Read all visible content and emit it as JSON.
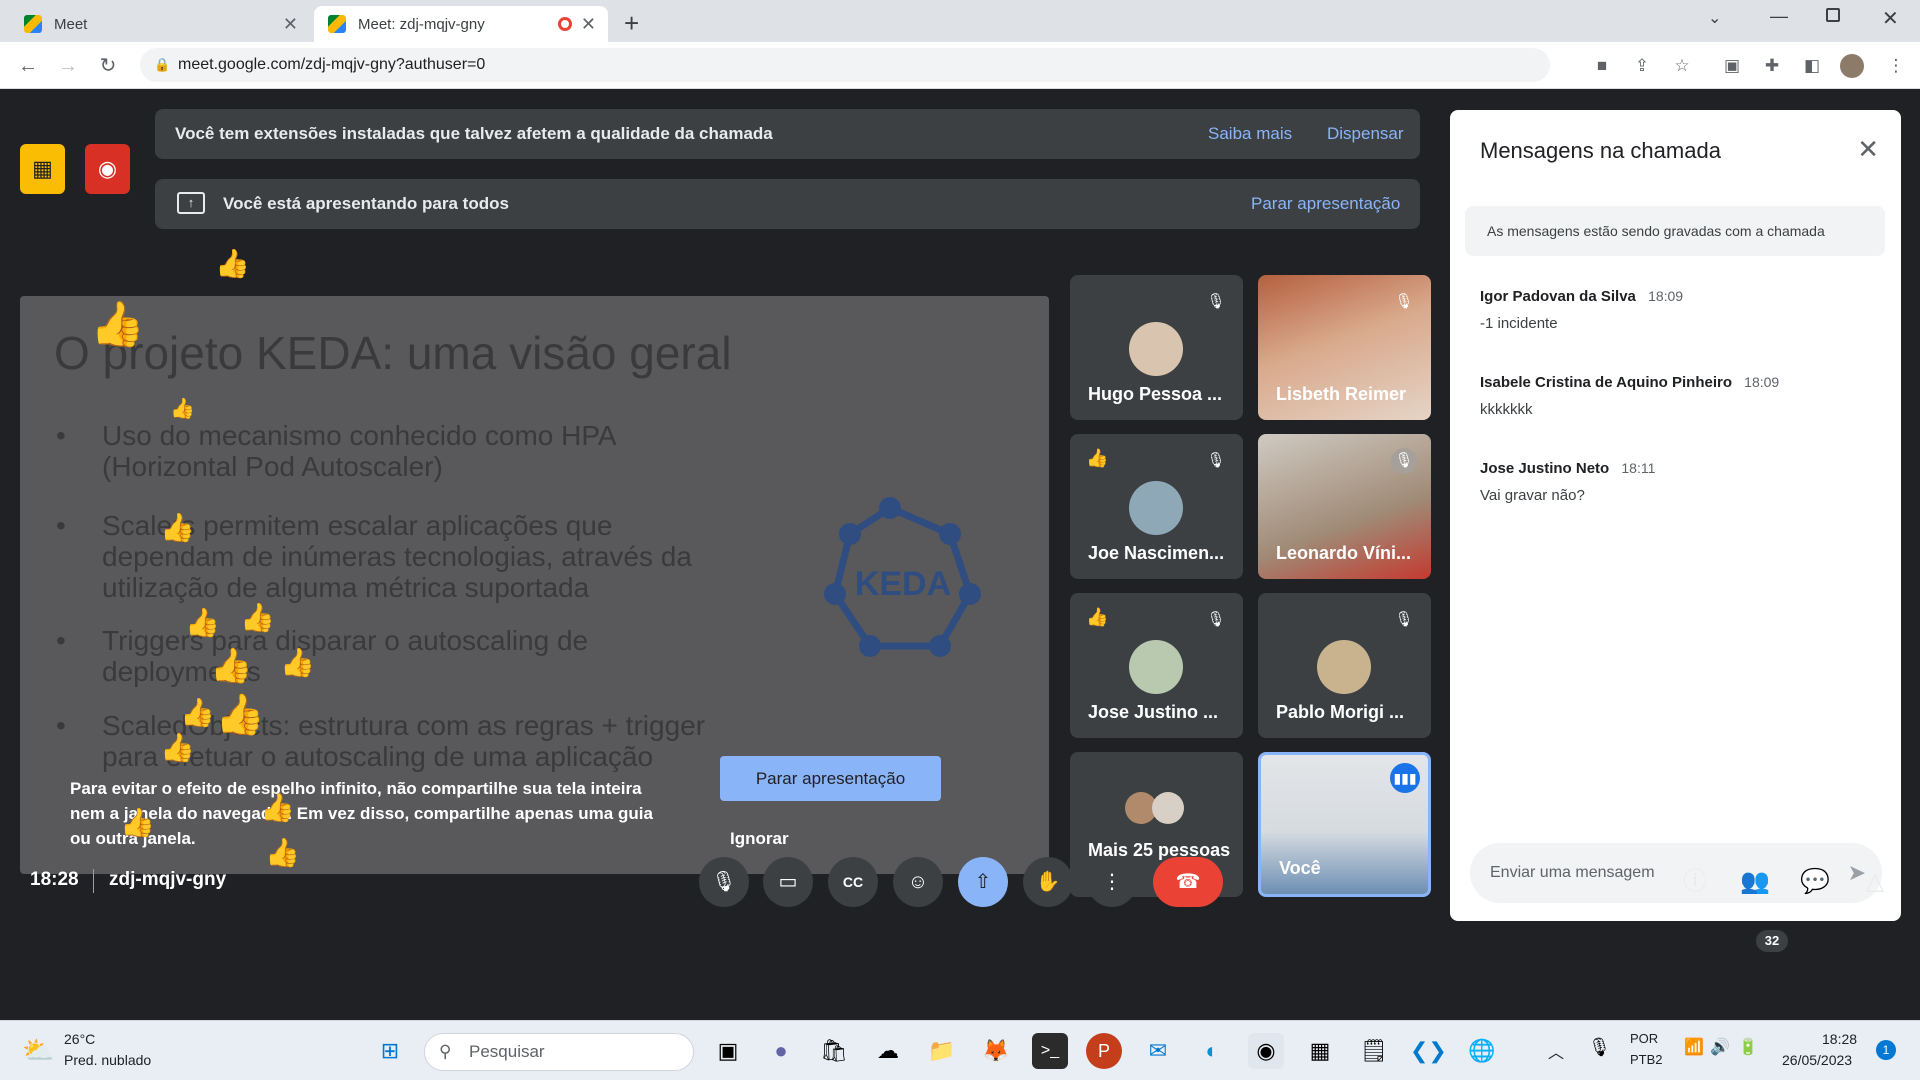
{
  "browser": {
    "tabs": [
      {
        "title": "Meet",
        "active": false
      },
      {
        "title": "Meet: zdj-mqjv-gny",
        "active": true,
        "recording": true
      }
    ],
    "url": "meet.google.com/zdj-mqjv-gny?authuser=0"
  },
  "banners": {
    "extensions": {
      "text": "Você tem extensões instaladas que talvez afetem a qualidade da chamada",
      "learn_more": "Saiba mais",
      "dismiss": "Dispensar"
    },
    "presenting": {
      "text": "Você está apresentando para todos",
      "stop": "Parar apresentação"
    }
  },
  "slide": {
    "title": "O projeto KEDA: uma visão geral",
    "bullets": [
      "Uso do mecanismo conhecido como HPA (Horizontal Pod Autoscaler)",
      "Scalers permitem escalar aplicações que dependam de inúmeras tecnologias, através da utilização de alguma métrica suportada",
      "Triggers para disparar o autoscaling de deployments",
      "ScaledObjects: estrutura com as regras + trigger para efetuar o autoscaling de uma aplicação"
    ],
    "logo_text": "KEDA"
  },
  "mirror_warning": {
    "text": "Para evitar o efeito de espelho infinito, não compartilhe sua tela inteira nem a janela do navegador. Em vez disso, compartilhe apenas uma guia ou outra janela.",
    "stop_button": "Parar apresentação",
    "ignore": "Ignorar"
  },
  "participants": [
    {
      "name": "Hugo Pessoa ...",
      "muted": true,
      "hand": ""
    },
    {
      "name": "Lisbeth Reimer",
      "muted": true,
      "hand": ""
    },
    {
      "name": "Joe Nascimen...",
      "muted": true,
      "hand": "👍"
    },
    {
      "name": "Leonardo Víni...",
      "muted": true,
      "hand": ""
    },
    {
      "name": "Jose Justino ...",
      "muted": true,
      "hand": "👍"
    },
    {
      "name": "Pablo Morigi ...",
      "muted": true,
      "hand": ""
    },
    {
      "name": "Mais 25 pessoas",
      "muted": false,
      "hand": ""
    },
    {
      "name": "Você",
      "muted": false,
      "hand": "",
      "speaking": true
    }
  ],
  "chat": {
    "title": "Mensagens na chamada",
    "note": "As mensagens estão sendo gravadas com a chamada",
    "messages": [
      {
        "author": "Igor Padovan da Silva",
        "time": "18:09",
        "text": "-1 incidente"
      },
      {
        "author": "Isabele Cristina de Aquino Pinheiro",
        "time": "18:09",
        "text": "kkkkkkk"
      },
      {
        "author": "Jose Justino Neto",
        "time": "18:11",
        "text": "Vai gravar não?"
      }
    ],
    "input_placeholder": "Enviar uma mensagem"
  },
  "meeting": {
    "time": "18:28",
    "code": "zdj-mqjv-gny",
    "people_count": "32"
  },
  "taskbar": {
    "weather_temp": "26°C",
    "weather_desc": "Pred. nublado",
    "search_placeholder": "Pesquisar",
    "lang": "POR",
    "layout": "PTB2",
    "clock_time": "18:28",
    "clock_date": "26/05/2023",
    "notifications": "1"
  },
  "colors": {
    "accent": "#8ab4f8",
    "hangup": "#ea4335",
    "present_active": "#8ab4f8"
  }
}
